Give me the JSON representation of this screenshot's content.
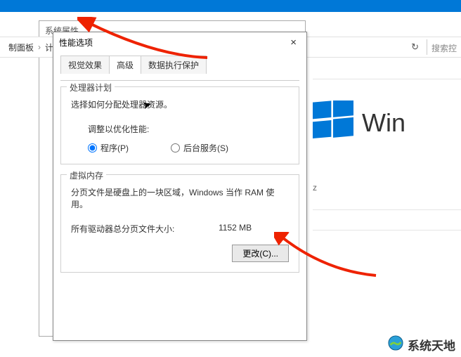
{
  "bluebar": {},
  "bgWindow": {
    "title": "系统属性"
  },
  "breadcrumb": {
    "items": [
      "制面板",
      "计算"
    ],
    "searchHint": "搜索控"
  },
  "rightPane": {
    "winword": "Win",
    "z": "z"
  },
  "dialog": {
    "title": "性能选项",
    "closeIcon": "×",
    "tabs": [
      {
        "label": "视觉效果",
        "active": false
      },
      {
        "label": "高级",
        "active": true
      },
      {
        "label": "数据执行保护",
        "active": false
      }
    ],
    "processor": {
      "title": "处理器计划",
      "desc": "选择如何分配处理器资源。",
      "adjustLabel": "调整以优化性能:",
      "radioPrograms": "程序(P)",
      "radioServices": "后台服务(S)"
    },
    "virtualMemory": {
      "title": "虚拟内存",
      "desc": "分页文件是硬盘上的一块区域，Windows 当作 RAM 使用。",
      "statLabel": "所有驱动器总分页文件大小:",
      "statValue": "1152 MB",
      "changeBtn": "更改(C)..."
    }
  },
  "watermark": {
    "text": "系统天地"
  }
}
